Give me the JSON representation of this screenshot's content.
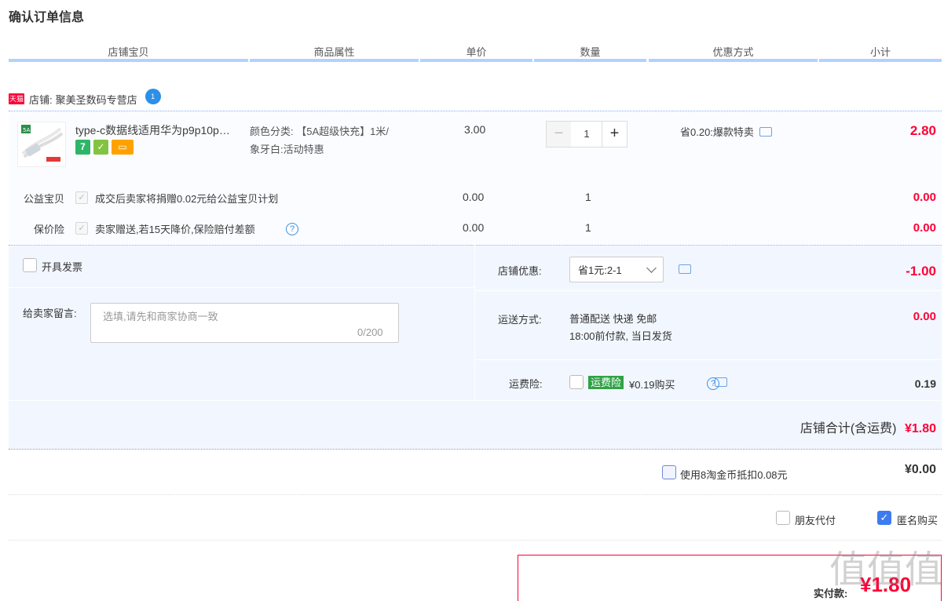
{
  "page": {
    "title": "确认订单信息"
  },
  "columns": [
    "店铺宝贝",
    "商品属性",
    "单价",
    "数量",
    "优惠方式",
    "小计"
  ],
  "shop": {
    "badge": "天猫",
    "label": "店铺:",
    "name": "聚美圣数码专营店",
    "chat_badge": "1"
  },
  "item": {
    "title": "type-c数据线适用华为p9p10p…",
    "thumb_text": "5A",
    "service_icons": [
      {
        "name": "7-day-return-icon",
        "text": "7",
        "color": "#2fb56a"
      },
      {
        "name": "guarantee-icon",
        "text": "✓",
        "color": "#82c341"
      },
      {
        "name": "card-pay-icon",
        "text": "▭",
        "color": "#ffa200"
      }
    ],
    "attributes": [
      "颜色分类: 【5A超级快充】1米/",
      "象牙白:活动特惠"
    ],
    "unit_price": "3.00",
    "quantity": "1",
    "qty_minus": "−",
    "qty_plus": "+",
    "promotion": "省0.20:爆款特卖",
    "subtotal": "2.80"
  },
  "charity": {
    "label": "公益宝贝",
    "text": "成交后卖家将捐赠0.02元给公益宝贝计划",
    "price": "0.00",
    "qty": "1",
    "subtotal": "0.00"
  },
  "insurance": {
    "label": "保价险",
    "text": "卖家赠送,若15天降价,保险赔付差额",
    "price": "0.00",
    "qty": "1",
    "subtotal": "0.00"
  },
  "invoice": {
    "label": "开具发票"
  },
  "message": {
    "label": "给卖家留言:",
    "placeholder": "选填,请先和商家协商一致",
    "counter": "0/200"
  },
  "shop_discount": {
    "label": "店铺优惠:",
    "selected": "省1元:2-1",
    "amount": "-1.00"
  },
  "shipping": {
    "label": "运送方式:",
    "line1": "普通配送 快递 免邮",
    "line2": "18:00前付款, 当日发货",
    "amount": "0.00"
  },
  "freight_insurance": {
    "label": "运费险:",
    "badge": "运费险",
    "text": "¥0.19购买",
    "amount": "0.19"
  },
  "shop_total": {
    "label": "店铺合计(含运费)",
    "amount": "¥1.80"
  },
  "coins": {
    "label": "使用8淘金币抵扣0.08元",
    "amount": "¥0.00"
  },
  "friend_pay": {
    "label": "朋友代付",
    "checked": false
  },
  "anonymous": {
    "label": "匿名购买",
    "checked": true
  },
  "payment": {
    "label": "实付款:",
    "amount": "¥1.80"
  },
  "watermark": {
    "text": "值值值"
  },
  "colors": {
    "accent_red": "#ff0036",
    "header_line": "#b2d1ff",
    "option_bg": "#f2f7ff",
    "checkbox_blue": "#3d7bf0"
  }
}
